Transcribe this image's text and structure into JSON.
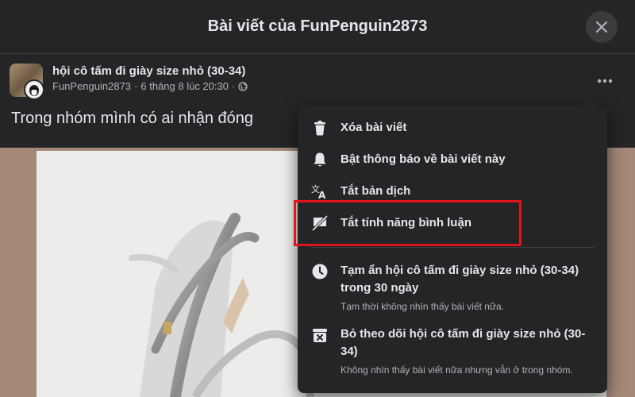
{
  "dialog": {
    "title": "Bài viết của FunPenguin2873"
  },
  "post": {
    "group_name": "hội cô tấm đi giày size nhỏ (30-34)",
    "author": "FunPenguin2873",
    "separator": "·",
    "date": "6 tháng 8 lúc 20:30",
    "text": "Trong nhóm mình có ai nhận đóng"
  },
  "menu": {
    "items": [
      {
        "label": "Xóa bài viết",
        "icon": "trash-icon"
      },
      {
        "label": "Bật thông báo về bài viết này",
        "icon": "bell-icon"
      },
      {
        "label": "Tắt bản dịch",
        "icon": "translate-icon"
      },
      {
        "label": "Tắt tính năng bình luận",
        "icon": "comment-off-icon"
      }
    ],
    "items2": [
      {
        "label": "Tạm ẩn hội cô tấm đi giày size nhỏ (30-34) trong 30 ngày",
        "desc": "Tạm thời không nhìn thấy bài viết nữa.",
        "icon": "clock-icon"
      },
      {
        "label": "Bỏ theo dõi hội cô tấm đi giày size nhỏ (30-34)",
        "desc": "Không nhìn thấy bài viết nữa nhưng vẫn ở trong nhóm.",
        "icon": "unfollow-icon"
      }
    ]
  },
  "colors": {
    "background": "#242526",
    "highlight": "#e0141e",
    "text": "#e4e6eb",
    "secondary_text": "#b0b3b8"
  }
}
